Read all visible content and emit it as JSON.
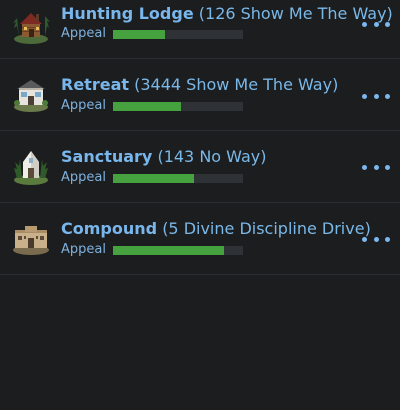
{
  "lots": [
    {
      "name": "Hunting Lodge",
      "address": "(126 Show Me The Way)",
      "appeal_label": "Appeal",
      "appeal_level": 0.4,
      "icon": "hunting-lodge-icon"
    },
    {
      "name": "Retreat",
      "address": "(3444 Show Me The Way)",
      "appeal_label": "Appeal",
      "appeal_level": 0.52,
      "icon": "retreat-house-icon"
    },
    {
      "name": "Sanctuary",
      "address": "(143 No Way)",
      "appeal_label": "Appeal",
      "appeal_level": 0.62,
      "icon": "sanctuary-icon"
    },
    {
      "name": "Compound",
      "address": "(5 Divine Discipline Drive)",
      "appeal_label": "Appeal",
      "appeal_level": 0.85,
      "icon": "compound-icon"
    }
  ],
  "colors": {
    "background": "#1c1d1f",
    "title_blue": "#79b6ec",
    "appeal_green": "#45a23f",
    "bar_track": "#2e3236"
  }
}
